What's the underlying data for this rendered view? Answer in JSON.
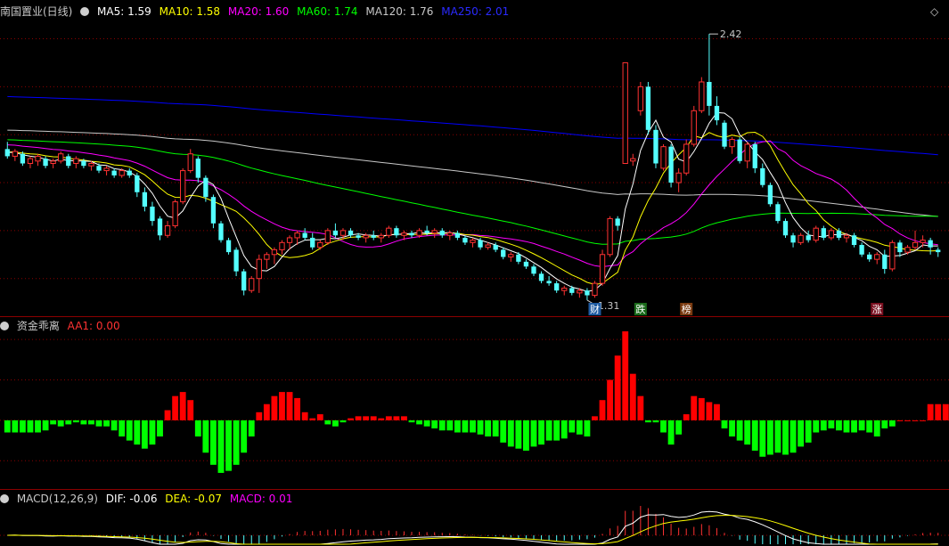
{
  "colors": {
    "bg": "#000000",
    "up": "#ff3232",
    "down": "#54ffff",
    "grid": "#8b0000",
    "ma5": "#ffffff",
    "ma10": "#ffff00",
    "ma20": "#ff00ff",
    "ma60": "#00ff00",
    "ma120": "#c8c8c8",
    "ma250": "#0000ff",
    "flow_up": "#ff0000",
    "flow_down": "#00ff00"
  },
  "header_main": {
    "title": "南国置业(日线)",
    "ma5": "MA5: 1.59",
    "ma10": "MA10: 1.58",
    "ma20": "MA20: 1.60",
    "ma60": "MA60: 1.74",
    "ma120": "MA120: 1.76",
    "ma250": "MA250: 2.01",
    "diamond": "◇"
  },
  "header_flow": {
    "title": "资金乖离",
    "value": "AA1: 0.00"
  },
  "header_macd": {
    "title": "MACD(12,26,9)",
    "dif": "DIF: -0.06",
    "dea": "DEA: -0.07",
    "macd": "MACD: 0.01"
  },
  "chart_data": [
    {
      "type": "candlestick",
      "title": "南国置业(日线)",
      "high_label": "2.42",
      "low_label": "1.31",
      "ylim": [
        1.28,
        2.48
      ],
      "markers": [
        "财",
        "跌",
        "榜",
        "涨"
      ],
      "ohlc": [
        [
          1.94,
          1.97,
          1.9,
          1.91
        ],
        [
          1.91,
          1.94,
          1.89,
          1.93
        ],
        [
          1.92,
          1.93,
          1.87,
          1.88
        ],
        [
          1.88,
          1.91,
          1.86,
          1.9
        ],
        [
          1.89,
          1.92,
          1.87,
          1.91
        ],
        [
          1.9,
          1.91,
          1.86,
          1.87
        ],
        [
          1.88,
          1.9,
          1.86,
          1.89
        ],
        [
          1.89,
          1.93,
          1.88,
          1.92
        ],
        [
          1.91,
          1.92,
          1.86,
          1.87
        ],
        [
          1.88,
          1.91,
          1.86,
          1.9
        ],
        [
          1.89,
          1.9,
          1.86,
          1.87
        ],
        [
          1.87,
          1.89,
          1.85,
          1.88
        ],
        [
          1.87,
          1.88,
          1.84,
          1.85
        ],
        [
          1.85,
          1.87,
          1.83,
          1.86
        ],
        [
          1.85,
          1.86,
          1.82,
          1.83
        ],
        [
          1.83,
          1.86,
          1.82,
          1.85
        ],
        [
          1.85,
          1.86,
          1.82,
          1.83
        ],
        [
          1.83,
          1.84,
          1.74,
          1.76
        ],
        [
          1.76,
          1.78,
          1.68,
          1.7
        ],
        [
          1.7,
          1.72,
          1.62,
          1.64
        ],
        [
          1.65,
          1.66,
          1.56,
          1.58
        ],
        [
          1.58,
          1.64,
          1.57,
          1.62
        ],
        [
          1.62,
          1.73,
          1.61,
          1.72
        ],
        [
          1.72,
          1.86,
          1.71,
          1.85
        ],
        [
          1.85,
          1.94,
          1.84,
          1.92
        ],
        [
          1.9,
          1.91,
          1.8,
          1.82
        ],
        [
          1.82,
          1.83,
          1.72,
          1.74
        ],
        [
          1.74,
          1.75,
          1.61,
          1.63
        ],
        [
          1.63,
          1.64,
          1.55,
          1.56
        ],
        [
          1.56,
          1.57,
          1.5,
          1.51
        ],
        [
          1.52,
          1.53,
          1.41,
          1.43
        ],
        [
          1.43,
          1.44,
          1.33,
          1.35
        ],
        [
          1.35,
          1.41,
          1.34,
          1.4
        ],
        [
          1.4,
          1.5,
          1.34,
          1.48
        ],
        [
          1.48,
          1.51,
          1.44,
          1.5
        ],
        [
          1.5,
          1.53,
          1.46,
          1.52
        ],
        [
          1.52,
          1.56,
          1.5,
          1.55
        ],
        [
          1.55,
          1.58,
          1.52,
          1.57
        ],
        [
          1.57,
          1.6,
          1.54,
          1.59
        ],
        [
          1.59,
          1.61,
          1.56,
          1.57
        ],
        [
          1.57,
          1.59,
          1.52,
          1.53
        ],
        [
          1.53,
          1.56,
          1.52,
          1.55
        ],
        [
          1.55,
          1.61,
          1.54,
          1.6
        ],
        [
          1.6,
          1.63,
          1.57,
          1.58
        ],
        [
          1.58,
          1.61,
          1.56,
          1.6
        ],
        [
          1.6,
          1.61,
          1.57,
          1.58
        ],
        [
          1.58,
          1.59,
          1.56,
          1.57
        ],
        [
          1.57,
          1.59,
          1.55,
          1.58
        ],
        [
          1.58,
          1.6,
          1.56,
          1.57
        ],
        [
          1.57,
          1.59,
          1.55,
          1.58
        ],
        [
          1.58,
          1.62,
          1.57,
          1.61
        ],
        [
          1.61,
          1.62,
          1.57,
          1.58
        ],
        [
          1.58,
          1.6,
          1.56,
          1.59
        ],
        [
          1.59,
          1.6,
          1.57,
          1.58
        ],
        [
          1.58,
          1.61,
          1.57,
          1.6
        ],
        [
          1.6,
          1.62,
          1.58,
          1.59
        ],
        [
          1.59,
          1.61,
          1.57,
          1.6
        ],
        [
          1.6,
          1.61,
          1.57,
          1.58
        ],
        [
          1.58,
          1.6,
          1.56,
          1.59
        ],
        [
          1.59,
          1.6,
          1.56,
          1.57
        ],
        [
          1.57,
          1.58,
          1.54,
          1.55
        ],
        [
          1.55,
          1.57,
          1.53,
          1.56
        ],
        [
          1.56,
          1.57,
          1.52,
          1.53
        ],
        [
          1.53,
          1.55,
          1.52,
          1.54
        ],
        [
          1.54,
          1.55,
          1.51,
          1.52
        ],
        [
          1.52,
          1.53,
          1.48,
          1.49
        ],
        [
          1.49,
          1.51,
          1.47,
          1.5
        ],
        [
          1.5,
          1.51,
          1.46,
          1.47
        ],
        [
          1.47,
          1.48,
          1.44,
          1.45
        ],
        [
          1.45,
          1.46,
          1.41,
          1.42
        ],
        [
          1.42,
          1.43,
          1.38,
          1.39
        ],
        [
          1.39,
          1.41,
          1.37,
          1.38
        ],
        [
          1.38,
          1.39,
          1.34,
          1.35
        ],
        [
          1.35,
          1.37,
          1.33,
          1.36
        ],
        [
          1.36,
          1.37,
          1.33,
          1.34
        ],
        [
          1.34,
          1.36,
          1.32,
          1.35
        ],
        [
          1.35,
          1.36,
          1.31,
          1.33
        ],
        [
          1.33,
          1.39,
          1.32,
          1.38
        ],
        [
          1.38,
          1.52,
          1.37,
          1.5
        ],
        [
          1.5,
          1.66,
          1.49,
          1.65
        ],
        [
          1.65,
          1.66,
          1.6,
          1.62
        ],
        [
          1.88,
          2.3,
          1.98,
          2.3
        ],
        [
          1.89,
          1.92,
          1.87,
          1.9
        ],
        [
          2.1,
          2.22,
          2.08,
          2.2
        ],
        [
          2.2,
          2.22,
          2.0,
          2.02
        ],
        [
          2.02,
          2.04,
          1.86,
          1.88
        ],
        [
          1.86,
          1.96,
          1.85,
          1.95
        ],
        [
          1.95,
          1.96,
          1.78,
          1.8
        ],
        [
          1.8,
          1.86,
          1.76,
          1.84
        ],
        [
          1.84,
          1.98,
          1.83,
          1.96
        ],
        [
          1.96,
          2.12,
          1.95,
          2.1
        ],
        [
          2.1,
          2.24,
          2.09,
          2.22
        ],
        [
          2.22,
          2.42,
          2.08,
          2.12
        ],
        [
          2.12,
          2.16,
          2.04,
          2.06
        ],
        [
          2.05,
          2.06,
          1.94,
          1.95
        ],
        [
          1.95,
          1.99,
          1.92,
          1.98
        ],
        [
          1.98,
          1.99,
          1.88,
          1.89
        ],
        [
          1.89,
          1.97,
          1.86,
          1.96
        ],
        [
          1.96,
          1.97,
          1.84,
          1.86
        ],
        [
          1.86,
          1.88,
          1.78,
          1.79
        ],
        [
          1.79,
          1.8,
          1.7,
          1.71
        ],
        [
          1.71,
          1.72,
          1.63,
          1.64
        ],
        [
          1.64,
          1.65,
          1.57,
          1.58
        ],
        [
          1.58,
          1.59,
          1.53,
          1.55
        ],
        [
          1.55,
          1.59,
          1.54,
          1.58
        ],
        [
          1.58,
          1.6,
          1.55,
          1.56
        ],
        [
          1.56,
          1.62,
          1.55,
          1.61
        ],
        [
          1.61,
          1.62,
          1.56,
          1.57
        ],
        [
          1.57,
          1.61,
          1.56,
          1.6
        ],
        [
          1.6,
          1.61,
          1.56,
          1.57
        ],
        [
          1.57,
          1.59,
          1.55,
          1.58
        ],
        [
          1.58,
          1.59,
          1.53,
          1.54
        ],
        [
          1.54,
          1.55,
          1.49,
          1.5
        ],
        [
          1.5,
          1.51,
          1.47,
          1.48
        ],
        [
          1.48,
          1.51,
          1.46,
          1.5
        ],
        [
          1.5,
          1.52,
          1.42,
          1.44
        ],
        [
          1.44,
          1.56,
          1.43,
          1.55
        ],
        [
          1.55,
          1.56,
          1.49,
          1.51
        ],
        [
          1.51,
          1.54,
          1.5,
          1.53
        ],
        [
          1.53,
          1.6,
          1.52,
          1.55
        ],
        [
          1.55,
          1.58,
          1.53,
          1.56
        ],
        [
          1.56,
          1.57,
          1.5,
          1.53
        ],
        [
          1.52,
          1.53,
          1.49,
          1.51
        ]
      ]
    },
    {
      "type": "bar",
      "title": "资金乖离",
      "series_name": "AA1",
      "ylim": [
        -30,
        44
      ],
      "values": [
        -6,
        -6,
        -6,
        -6,
        -6,
        -5,
        -2,
        -3,
        -2,
        -1,
        -2,
        -2,
        -3,
        -3,
        -5,
        -8,
        -10,
        -12,
        -14,
        -12,
        -8,
        5,
        12,
        14,
        10,
        -8,
        -16,
        -22,
        -26,
        -25,
        -22,
        -16,
        -8,
        4,
        8,
        12,
        14,
        14,
        11,
        4,
        1,
        3,
        -2,
        -3,
        -1,
        1,
        2,
        2,
        2,
        1,
        2,
        2,
        2,
        -1,
        -2,
        -3,
        -4,
        -5,
        -5,
        -6,
        -6,
        -6,
        -7,
        -8,
        -8,
        -11,
        -13,
        -14,
        -15,
        -13,
        -12,
        -10,
        -10,
        -9,
        -6,
        -7,
        -8,
        2,
        10,
        20,
        32,
        44,
        23,
        12,
        -1,
        -1,
        -6,
        -12,
        -7,
        3,
        12,
        11,
        9,
        8,
        -4,
        -8,
        -10,
        -12,
        -15,
        -18,
        -17,
        -16,
        -17,
        -16,
        -13,
        -11,
        -6,
        -5,
        -4,
        -5,
        -6,
        -6,
        -5,
        -6,
        -8,
        -4,
        -3,
        0,
        0,
        0,
        0,
        8,
        8,
        8,
        -4,
        -5
      ]
    },
    {
      "type": "line",
      "title": "MACD(12,26,9)",
      "series": [
        {
          "name": "DIF",
          "last": -0.06
        },
        {
          "name": "DEA",
          "last": -0.07
        },
        {
          "name": "MACD",
          "last": 0.01
        }
      ]
    }
  ]
}
